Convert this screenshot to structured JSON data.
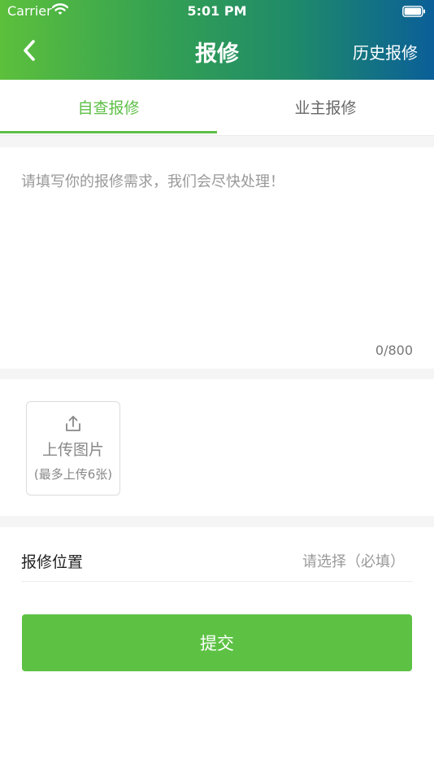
{
  "status_bar": {
    "carrier": "Carrier",
    "time": "5:01 PM"
  },
  "header": {
    "title": "报修",
    "history_label": "历史报修",
    "gradient_start": "#5cc03c",
    "gradient_end": "#0a5f98"
  },
  "tabs": [
    {
      "label": "自查报修",
      "active": true
    },
    {
      "label": "业主报修",
      "active": false
    }
  ],
  "description": {
    "value": "",
    "placeholder": "请填写你的报修需求，我们会尽快处理！",
    "char_count": "0/800"
  },
  "upload": {
    "label": "上传图片",
    "note": "(最多上传6张)"
  },
  "location": {
    "label": "报修位置",
    "placeholder": "请选择（必填）"
  },
  "submit": {
    "label": "提交"
  },
  "colors": {
    "accent": "#5cbf45",
    "button": "#5dc244",
    "section_gap": "#f5f5f5"
  }
}
